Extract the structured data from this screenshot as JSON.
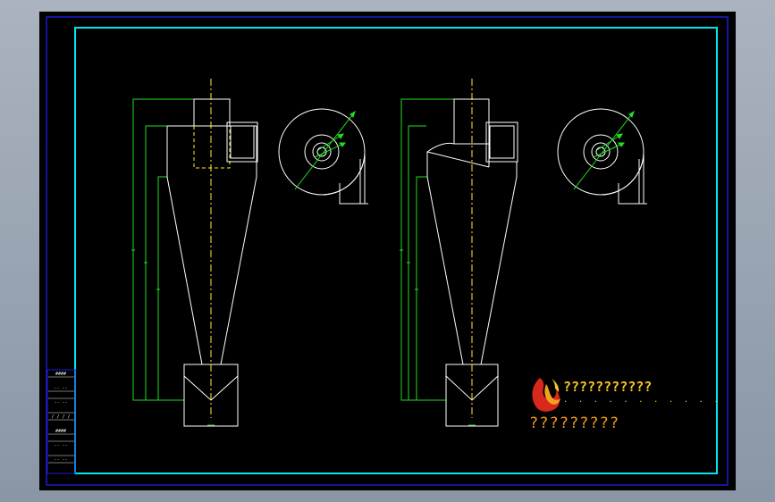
{
  "colors": {
    "background": "#000000",
    "outer_border": "#1c1cd0",
    "inner_border": "#00e6ee",
    "geometry": "#ffffff",
    "dimension": "#22dd22",
    "centerline": "#ffee33",
    "brand_yellow": "#f3c52a",
    "brand_orange": "#f39a1e",
    "logo_red": "#d8281c"
  },
  "views": [
    {
      "name": "cyclone-front-view-1",
      "variant": "rectangular-inlet"
    },
    {
      "name": "cyclone-top-view-1"
    },
    {
      "name": "cyclone-front-view-2",
      "variant": "tangential-inlet"
    },
    {
      "name": "cyclone-top-view-2"
    }
  ],
  "brand": {
    "logo_icon": "flame-logo-icon",
    "line1": "???????????",
    "line2": ". . . . . . . . . . .",
    "line3": "?????????"
  },
  "title_block": {
    "rows": [
      "####",
      "-- --",
      "-- --",
      "/ / / /",
      "####",
      "-- --",
      "-- --"
    ]
  }
}
